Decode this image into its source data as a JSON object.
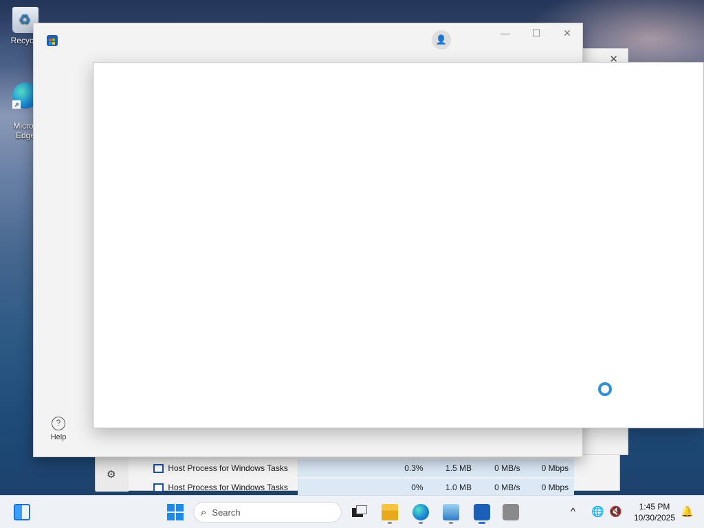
{
  "desktop": {
    "icons": [
      {
        "label": "Recycle",
        "icon": "recycle-bin-icon"
      },
      {
        "label": "Micros\nEdge",
        "icon": "edge-icon"
      }
    ]
  },
  "task_manager": {
    "rows": [
      {
        "name": "Host Process for Windows Tasks",
        "cpu": "0.3%",
        "memory": "1.5 MB",
        "disk": "0 MB/s",
        "network": "0 Mbps"
      },
      {
        "name": "Host Process for Windows Tasks",
        "cpu": "0%",
        "memory": "1.0 MB",
        "disk": "0 MB/s",
        "network": "0 Mbps"
      }
    ]
  },
  "store_window": {
    "window_controls": {
      "minimize": "—",
      "maximize": "☐",
      "close": "✕"
    },
    "help_label": "Help",
    "help_glyph": "?"
  },
  "dialog": {
    "state": "loading"
  },
  "taskbar": {
    "search_placeholder": "Search",
    "clock_time": "1:45 PM",
    "clock_date": "10/30/2025",
    "tray_chevron": "^"
  },
  "colors": {
    "accent": "#1f8ae6",
    "spinner": "#2f8fd8",
    "taskbar_bg": "#eef1f6"
  }
}
